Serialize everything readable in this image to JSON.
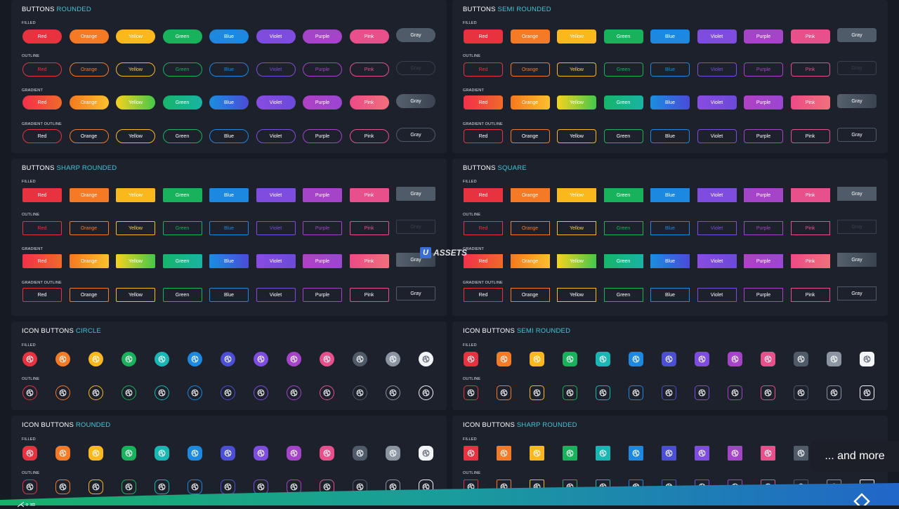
{
  "panels": [
    {
      "title_main": "BUTTONS",
      "title_accent": "ROUNDED",
      "kind": "buttons",
      "radius": "10px",
      "rows": [
        {
          "label": "FILLED",
          "style": "filled"
        },
        {
          "label": "OUTLINE",
          "style": "outline"
        },
        {
          "label": "GRADIENT",
          "style": "gradient"
        },
        {
          "label": "GRADIENT OUTLINE",
          "style": "gout"
        }
      ]
    },
    {
      "title_main": "BUTTONS",
      "title_accent": "SEMI ROUNDED",
      "kind": "buttons",
      "radius": "4px",
      "rows": [
        {
          "label": "FILLED",
          "style": "filled"
        },
        {
          "label": "OUTLINE",
          "style": "outline"
        },
        {
          "label": "GRADIENT",
          "style": "gradient"
        },
        {
          "label": "GRADIENT OUTLINE",
          "style": "gout"
        }
      ]
    },
    {
      "title_main": "BUTTONS",
      "title_accent": "SHARP ROUNDED",
      "kind": "buttons",
      "radius": "2px",
      "rows": [
        {
          "label": "FILLED",
          "style": "filled"
        },
        {
          "label": "OUTLINE",
          "style": "outline"
        },
        {
          "label": "GRADIENT",
          "style": "gradient"
        },
        {
          "label": "GRADIENT OUTLINE",
          "style": "gout"
        }
      ]
    },
    {
      "title_main": "BUTTONS",
      "title_accent": "SQUARE",
      "kind": "buttons",
      "radius": "0px",
      "rows": [
        {
          "label": "FILLED",
          "style": "filled"
        },
        {
          "label": "OUTLINE",
          "style": "outline"
        },
        {
          "label": "GRADIENT",
          "style": "gradient"
        },
        {
          "label": "GRADIENT OUTLINE",
          "style": "gout"
        }
      ]
    },
    {
      "title_main": "ICON BUTTONS",
      "title_accent": "CIRCLE",
      "kind": "icons",
      "radius": "50%",
      "rows": [
        {
          "label": "FILLED",
          "style": "filled"
        },
        {
          "label": "OUTLINE",
          "style": "outline"
        }
      ]
    },
    {
      "title_main": "ICON BUTTONS",
      "title_accent": "SEMI ROUNDED",
      "kind": "icons",
      "radius": "5px",
      "rows": [
        {
          "label": "FILLED",
          "style": "filled"
        },
        {
          "label": "OUTLINE",
          "style": "outline"
        }
      ]
    },
    {
      "title_main": "ICON BUTTONS",
      "title_accent": "ROUNDED",
      "kind": "icons",
      "radius": "7px",
      "rows": [
        {
          "label": "FILLED",
          "style": "filled"
        },
        {
          "label": "OUTLINE",
          "style": "outline"
        }
      ]
    },
    {
      "title_main": "ICON BUTTONS",
      "title_accent": "SHARP ROUNDED",
      "kind": "icons",
      "radius": "2px",
      "rows": [
        {
          "label": "FILLED",
          "style": "filled"
        },
        {
          "label": "OUTLINE",
          "style": "outline"
        }
      ]
    }
  ],
  "button_colors": [
    {
      "name": "Red",
      "color": "#e8323f",
      "g1": "#f2304a",
      "g2": "#f06a2a"
    },
    {
      "name": "Orange",
      "color": "#f57a25",
      "g1": "#f5781e",
      "g2": "#fbc02d"
    },
    {
      "name": "Yellow",
      "color": "#fbb81c",
      "g1": "#f7d21e",
      "g2": "#44c84a"
    },
    {
      "name": "Green",
      "color": "#17b25b",
      "g1": "#16b56b",
      "g2": "#19b3a3"
    },
    {
      "name": "Blue",
      "color": "#1c88e0",
      "g1": "#1a8ee0",
      "g2": "#4a4bd8"
    },
    {
      "name": "Violet",
      "color": "#7e4de0",
      "g1": "#8a4be2",
      "g2": "#6b4ad9"
    },
    {
      "name": "Purple",
      "color": "#a544c9",
      "g1": "#b041c4",
      "g2": "#9a46d2"
    },
    {
      "name": "Pink",
      "color": "#e8508c",
      "g1": "#ec4a86",
      "g2": "#f0707c"
    },
    {
      "name": "Gray",
      "color": "#4f5b69",
      "g1": "#55606d",
      "g2": "#3a4450"
    }
  ],
  "icon_colors": [
    "#e8323f",
    "#f57a25",
    "#fbb81c",
    "#17b25b",
    "#19b7b3",
    "#1c88e0",
    "#4a4fd6",
    "#7e4de0",
    "#a544c9",
    "#e8508c",
    "#4f5b69",
    "#8b95a1",
    "#f2f4f7"
  ],
  "icon_name": "dribbble-icon",
  "watermark": {
    "letter": "U",
    "text": "ASSETS"
  },
  "more_text": "... and more",
  "bottom_left_text": "⋌∘⋍"
}
